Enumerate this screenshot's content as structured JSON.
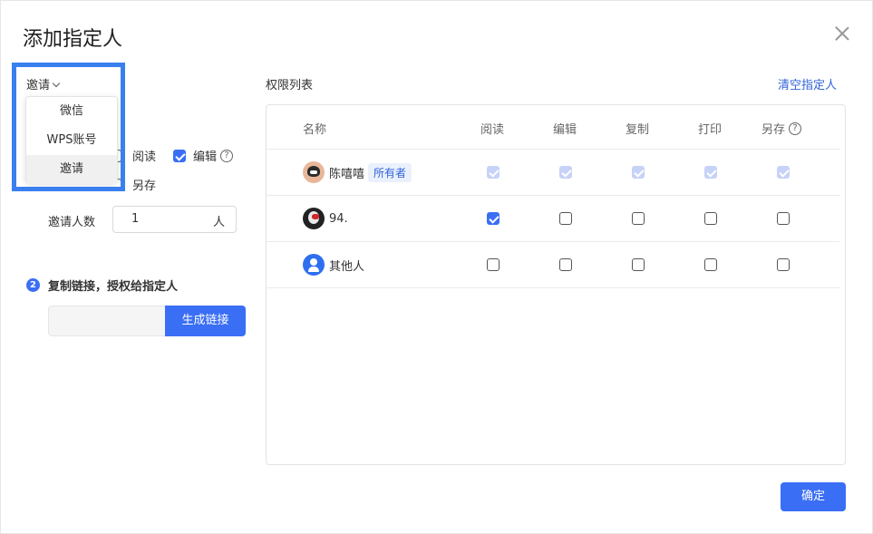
{
  "dialog": {
    "title": "添加指定人"
  },
  "invite": {
    "trigger_label": "邀请",
    "menu": [
      "微信",
      "WPS账号",
      "邀请"
    ],
    "perms": {
      "read": "阅读",
      "edit": "编辑",
      "save": "另存"
    },
    "count_label": "邀请人数",
    "count_value": "1",
    "count_unit": "人"
  },
  "step2": {
    "number": "2",
    "label": "复制链接，授权给指定人",
    "button": "生成链接"
  },
  "perm_list": {
    "title": "权限列表",
    "clear": "清空指定人",
    "headers": [
      "名称",
      "阅读",
      "编辑",
      "复制",
      "打印",
      "另存"
    ],
    "rows": [
      {
        "name": "陈嘻嘻",
        "badge": "所有者",
        "checks": [
          true,
          true,
          true,
          true,
          true
        ],
        "disabled": true
      },
      {
        "name": "94.",
        "checks": [
          true,
          false,
          false,
          false,
          false
        ],
        "disabled": false
      },
      {
        "name": "其他人",
        "checks": [
          false,
          false,
          false,
          false,
          false
        ],
        "disabled": false
      }
    ]
  },
  "footer": {
    "ok": "确定"
  },
  "colors": {
    "accent": "#3a6ef5",
    "link": "#2f63d8",
    "highlight": "#3a7ff0"
  }
}
